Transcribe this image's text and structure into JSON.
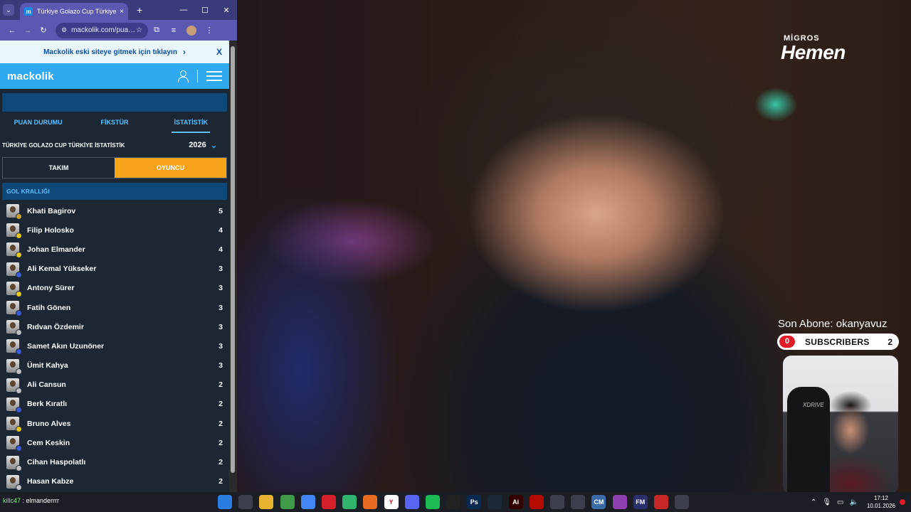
{
  "browser": {
    "tab_title": "Türkiye Golazo Cup Türkiye 20…",
    "tab_favicon": "m",
    "url": "mackolik.com/pua…",
    "new_tab": "+",
    "close_tab": "×"
  },
  "banner": {
    "text": "Mackolik eski siteye gitmek için tıklayın",
    "close": "X"
  },
  "site": {
    "logo": "mackolik"
  },
  "tabs": [
    {
      "label": "PUAN DURUMU"
    },
    {
      "label": "FİKSTÜR"
    },
    {
      "label": "İSTATİSTİK"
    }
  ],
  "stats": {
    "title": "TÜRKİYE GOLAZO CUP TÜRKİYE İSTATİSTİK",
    "year": "2026",
    "toggle_team": "TAKIM",
    "toggle_player": "OYUNCU",
    "section": "GOL KRALLIĞI"
  },
  "players": [
    {
      "name": "Khati Bagirov",
      "goals": "5",
      "badge": "#c9a227"
    },
    {
      "name": "Filip Holosko",
      "goals": "4",
      "badge": "#e6c619"
    },
    {
      "name": "Johan Elmander",
      "goals": "4",
      "badge": "#e6c619"
    },
    {
      "name": "Ali Kemal Yükseker",
      "goals": "3",
      "badge": "#3b5bd6"
    },
    {
      "name": "Antony Sürer",
      "goals": "3",
      "badge": "#e6c619"
    },
    {
      "name": "Fatih Gönen",
      "goals": "3",
      "badge": "#3b5bd6"
    },
    {
      "name": "Rıdvan Özdemir",
      "goals": "3",
      "badge": "#c0c0c0"
    },
    {
      "name": "Samet Akın Uzunöner",
      "goals": "3",
      "badge": "#3b5bd6"
    },
    {
      "name": "Ümit Kahya",
      "goals": "3",
      "badge": "#c0c0c0"
    },
    {
      "name": "Ali Cansun",
      "goals": "2",
      "badge": "#c0c0c0"
    },
    {
      "name": "Berk Kıratlı",
      "goals": "2",
      "badge": "#3b5bd6"
    },
    {
      "name": "Bruno Alves",
      "goals": "2",
      "badge": "#e6c619"
    },
    {
      "name": "Cem Keskin",
      "goals": "2",
      "badge": "#3b5bd6"
    },
    {
      "name": "Cihan Haspolatlı",
      "goals": "2",
      "badge": "#c0c0c0"
    },
    {
      "name": "Hasan Kabze",
      "goals": "2",
      "badge": "#c0c0c0"
    }
  ],
  "overlay": {
    "sponsor_top": "MİGROS",
    "sponsor_main": "Hemen",
    "last_sub": "Son Abone: okanyavuz",
    "subs_left": "0",
    "subs_label": "SUBSCRIBERS",
    "subs_right": "2",
    "webcam_brand": "XDRIVE"
  },
  "taskbar": {
    "chat_user": "killc47",
    "chat_msg": " : elmanderrrr",
    "time": "17:12",
    "date": "10.01.2026",
    "apps": [
      {
        "icon": "windows-start-icon",
        "label": "",
        "color": "#2a7de1"
      },
      {
        "icon": "task-view-icon",
        "label": "",
        "color": "#3a3f4b"
      },
      {
        "icon": "file-explorer-icon",
        "label": "",
        "color": "#e8b331"
      },
      {
        "icon": "chrome-icon",
        "label": "",
        "color": "#3f9b47"
      },
      {
        "icon": "chrome-icon",
        "label": "",
        "color": "#4285f4"
      },
      {
        "icon": "opera-icon",
        "label": "",
        "color": "#d3202a"
      },
      {
        "icon": "app-icon",
        "label": "",
        "color": "#30b46d"
      },
      {
        "icon": "firefox-icon",
        "label": "",
        "color": "#e66a1f"
      },
      {
        "icon": "yandex-icon",
        "label": "Y",
        "color": "#ffffff"
      },
      {
        "icon": "discord-icon",
        "label": "",
        "color": "#5865f2"
      },
      {
        "icon": "spotify-icon",
        "label": "",
        "color": "#1db954"
      },
      {
        "icon": "capcut-icon",
        "label": "",
        "color": "#222222"
      },
      {
        "icon": "photoshop-icon",
        "label": "Ps",
        "color": "#0b2a52"
      },
      {
        "icon": "steam-icon",
        "label": "",
        "color": "#1b2838"
      },
      {
        "icon": "illustrator-icon",
        "label": "Ai",
        "color": "#330000"
      },
      {
        "icon": "acrobat-icon",
        "label": "",
        "color": "#b30b00"
      },
      {
        "icon": "camera-icon",
        "label": "",
        "color": "#3a3f4b"
      },
      {
        "icon": "football-icon",
        "label": "",
        "color": "#3a3f4b"
      },
      {
        "icon": "cm-icon",
        "label": "CM",
        "color": "#3b6aa8"
      },
      {
        "icon": "app-icon",
        "label": "",
        "color": "#8d3fb0"
      },
      {
        "icon": "fm-icon",
        "label": "FM",
        "color": "#2b2f6b"
      },
      {
        "icon": "recorder-icon",
        "label": "",
        "color": "#c62828"
      },
      {
        "icon": "obs-icon",
        "label": "",
        "color": "#3a3f4b"
      }
    ]
  }
}
